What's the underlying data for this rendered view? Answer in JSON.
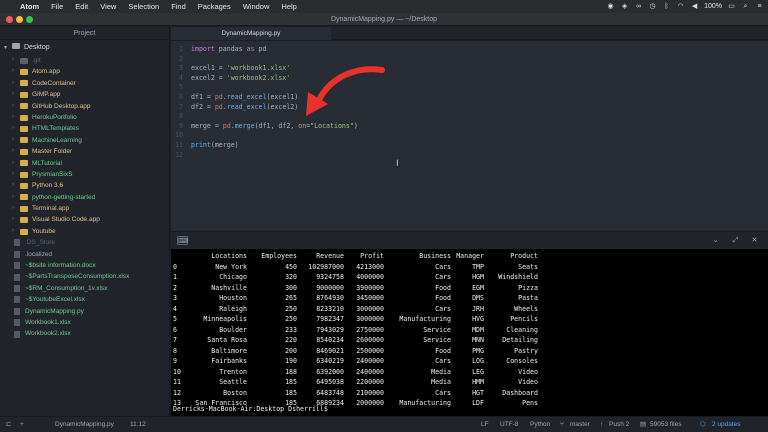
{
  "menubar": {
    "app": "Atom",
    "items": [
      "File",
      "Edit",
      "View",
      "Selection",
      "Find",
      "Packages",
      "Window",
      "Help"
    ],
    "battery": "100%",
    "battery_icon": "battery-icon",
    "wifi_icon": "wifi-icon"
  },
  "window": {
    "title": "DynamicMapping.py — ~/Desktop"
  },
  "tree": {
    "header": "Project",
    "root": "Desktop",
    "items": [
      {
        "label": ".git",
        "kind": "folder",
        "color": "dim"
      },
      {
        "label": "Atom.app",
        "kind": "folder",
        "color": "yellow"
      },
      {
        "label": "CodeContainer",
        "kind": "folder",
        "color": "yellow"
      },
      {
        "label": "GIMP.app",
        "kind": "folder",
        "color": "yellow"
      },
      {
        "label": "GitHub Desktop.app",
        "kind": "folder",
        "color": "yellow"
      },
      {
        "label": "HerokuPortfolio",
        "kind": "folder",
        "color": "green"
      },
      {
        "label": "HTMLTemplates",
        "kind": "folder",
        "color": "green"
      },
      {
        "label": "MachineLearning",
        "kind": "folder",
        "color": "green"
      },
      {
        "label": "Master Folder",
        "kind": "folder",
        "color": "yellow"
      },
      {
        "label": "MLTutorial",
        "kind": "folder",
        "color": "green"
      },
      {
        "label": "PrysmianSixS",
        "kind": "folder",
        "color": "green"
      },
      {
        "label": "Python 3.6",
        "kind": "folder",
        "color": "yellow"
      },
      {
        "label": "python-getting-started",
        "kind": "folder",
        "color": "green"
      },
      {
        "label": "Terminal.app",
        "kind": "folder",
        "color": "yellow"
      },
      {
        "label": "Visual Studio Code.app",
        "kind": "folder",
        "color": "yellow"
      },
      {
        "label": "Youtube",
        "kind": "folder",
        "color": "yellow"
      },
      {
        "label": ".DS_Store",
        "kind": "file",
        "color": "dim"
      },
      {
        "label": ".localized",
        "kind": "file",
        "color": "normal"
      },
      {
        "label": "~$bsite information.docx",
        "kind": "file",
        "color": "green"
      },
      {
        "label": "~$PartsTransposeConsumption.xlsx",
        "kind": "file",
        "color": "green"
      },
      {
        "label": "~$RM_Consumption_1v.xlsx",
        "kind": "file",
        "color": "green"
      },
      {
        "label": "~$YoutubeExcel.xlsx",
        "kind": "file",
        "color": "green"
      },
      {
        "label": "DynamicMapping.py",
        "kind": "file",
        "color": "green"
      },
      {
        "label": "Workbook1.xlsx",
        "kind": "file",
        "color": "green"
      },
      {
        "label": "Workbook2.xlsx",
        "kind": "file",
        "color": "green"
      }
    ]
  },
  "tabs": [
    {
      "label": "DynamicMapping.py",
      "active": true
    }
  ],
  "editor": {
    "lines": [
      {
        "n": "1",
        "tokens": [
          [
            "kw",
            "import"
          ],
          [
            "plain",
            " pandas "
          ],
          [
            "kw",
            "as"
          ],
          [
            "plain",
            " pd"
          ]
        ]
      },
      {
        "n": "2",
        "tokens": []
      },
      {
        "n": "3",
        "tokens": [
          [
            "plain",
            "excel1 = "
          ],
          [
            "str",
            "'workbook1.xlsx'"
          ]
        ]
      },
      {
        "n": "4",
        "tokens": [
          [
            "plain",
            "excel2 = "
          ],
          [
            "str",
            "'workbook2.xlsx'"
          ]
        ]
      },
      {
        "n": "5",
        "tokens": []
      },
      {
        "n": "6",
        "tokens": [
          [
            "plain",
            "df1 = "
          ],
          [
            "var",
            "pd"
          ],
          [
            "plain",
            "."
          ],
          [
            "fn",
            "read_excel"
          ],
          [
            "plain",
            "(excel1)"
          ]
        ]
      },
      {
        "n": "7",
        "tokens": [
          [
            "plain",
            "df2 = "
          ],
          [
            "var",
            "pd"
          ],
          [
            "plain",
            "."
          ],
          [
            "fn",
            "read_excel"
          ],
          [
            "plain",
            "(excel2)"
          ]
        ]
      },
      {
        "n": "8",
        "tokens": []
      },
      {
        "n": "9",
        "tokens": [
          [
            "plain",
            "merge = "
          ],
          [
            "var",
            "pd"
          ],
          [
            "plain",
            "."
          ],
          [
            "fn",
            "merge"
          ],
          [
            "plain",
            "(df1, df2, "
          ],
          [
            "kwarg",
            "on"
          ],
          [
            "plain",
            "="
          ],
          [
            "str",
            "\"Locations\""
          ],
          [
            "plain",
            ")"
          ]
        ]
      },
      {
        "n": "10",
        "tokens": []
      },
      {
        "n": "11",
        "tokens": [
          [
            "fn",
            "print"
          ],
          [
            "plain",
            "(merge)"
          ]
        ]
      },
      {
        "n": "12",
        "tokens": []
      }
    ],
    "cursor": "I"
  },
  "terminal": {
    "columns": [
      "Locations",
      "Employees",
      "Revenue",
      "Profit",
      "Business",
      "Manager",
      "Product"
    ],
    "rows": [
      [
        "0",
        "New York",
        "450",
        "102987000",
        "4213000",
        "Cars",
        "TMP",
        "Seats"
      ],
      [
        "1",
        "Chicago",
        "320",
        "9324758",
        "4000000",
        "Cars",
        "HGM",
        "Windshield"
      ],
      [
        "2",
        "Nashville",
        "300",
        "9000000",
        "3900000",
        "Food",
        "EGM",
        "Pizza"
      ],
      [
        "3",
        "Houston",
        "265",
        "8764930",
        "3450000",
        "Food",
        "DMS",
        "Pasta"
      ],
      [
        "4",
        "Raleigh",
        "250",
        "8233210",
        "3000000",
        "Cars",
        "JRH",
        "Wheels"
      ],
      [
        "5",
        "Minneapolis",
        "250",
        "7982347",
        "3000000",
        "Manufacturing",
        "HVG",
        "Pencils"
      ],
      [
        "6",
        "Boulder",
        "233",
        "7943029",
        "2750000",
        "Service",
        "MDM",
        "Cleaning"
      ],
      [
        "7",
        "Santa Rosa",
        "220",
        "8540234",
        "2600000",
        "Service",
        "MNN",
        "Detailing"
      ],
      [
        "8",
        "Baltimore",
        "200",
        "8469021",
        "2500000",
        "Food",
        "PMG",
        "Pastry"
      ],
      [
        "9",
        "Fairbanks",
        "190",
        "6340219",
        "2400000",
        "Cars",
        "LOG",
        "Consoles"
      ],
      [
        "10",
        "Trenton",
        "188",
        "6392000",
        "2400000",
        "Media",
        "LEG",
        "Video"
      ],
      [
        "11",
        "Seattle",
        "185",
        "6495038",
        "2200000",
        "Media",
        "HMM",
        "Video"
      ],
      [
        "12",
        "Boston",
        "185",
        "6483748",
        "2100000",
        "Cars",
        "HGT",
        "Dashboard"
      ],
      [
        "13",
        "San Francisco",
        "185",
        "6889234",
        "2000000",
        "Manufacturing",
        "LDF",
        "Pens"
      ]
    ],
    "prompt": "Derricks-MacBook-Air:Desktop Dsherrill$"
  },
  "status": {
    "file": "DynamicMapping.py",
    "cursor": "11:12",
    "line_ending": "LF",
    "encoding": "UTF-8",
    "grammar": "Python",
    "branch": "master",
    "push": "Push 2",
    "files": "59053 files",
    "updates": "2 updates"
  },
  "colors": {
    "accent": "#5a9df3",
    "arrow": "#e8322b",
    "background": "#282c34"
  }
}
